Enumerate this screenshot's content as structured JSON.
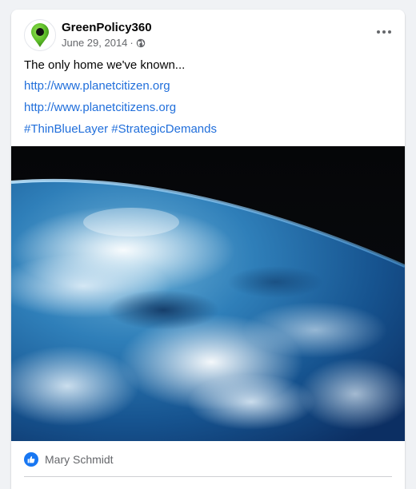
{
  "post": {
    "page_name": "GreenPolicy360",
    "date": "June 29, 2014",
    "separator": "·",
    "privacy_icon": "globe-icon",
    "more_icon": "more-options-icon",
    "text": "The only home we've known...",
    "links": [
      "http://www.planetcitizen.org",
      "http://www.planetcitizens.org"
    ],
    "hashtags": [
      "#ThinBlueLayer",
      "#StrategicDemands"
    ],
    "image_icon": "earth-from-space-photo"
  },
  "reactions": {
    "icon": "like-icon",
    "reactor_name": "Mary Schmidt"
  },
  "colors": {
    "link": "#216fdb",
    "text": "#050505",
    "secondary": "#65676b",
    "like_blue": "#1877f2",
    "avatar_green": "#5fbf2a"
  }
}
